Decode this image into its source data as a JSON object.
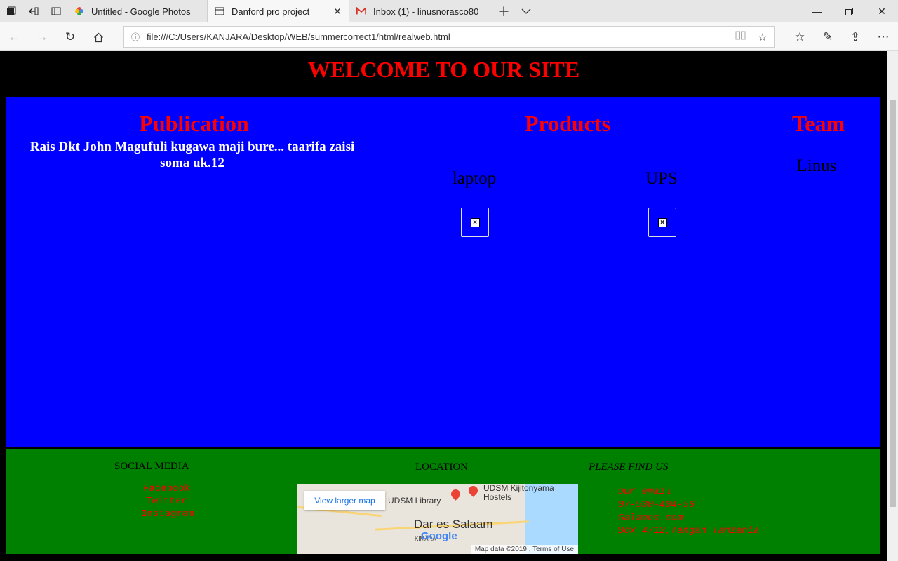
{
  "browser": {
    "tabs": [
      {
        "title": "Untitled - Google Photos"
      },
      {
        "title": "Danford pro project"
      },
      {
        "title": "Inbox (1) - linusnorasco804("
      }
    ],
    "url": "file:///C:/Users/KANJARA/Desktop/WEB/summercorrect1/html/realweb.html"
  },
  "page": {
    "welcome": "WELCOME TO OUR SITE",
    "publication": {
      "heading": "Publication",
      "text": "Rais Dkt John Magufuli kugawa maji bure... taarifa zaisi soma uk.12"
    },
    "products": {
      "heading": "Products",
      "items": [
        {
          "name": "laptop"
        },
        {
          "name": "UPS"
        }
      ]
    },
    "team": {
      "heading": "Team",
      "members": [
        "Linus"
      ]
    },
    "footer": {
      "social_heading": "SOCIAL MEDIA",
      "social_links": [
        "Facebook",
        "Twitter",
        "Instagram"
      ],
      "location_heading": "LOCATION",
      "map": {
        "view_larger": "View larger map",
        "library": "UDSM Library",
        "hostels": "UDSM Kijitonyama Hostels",
        "city": "Dar es Salaam",
        "district": "KIMARA",
        "logo": "Google",
        "attribution": "Map data ©2019 , Terms of Use"
      },
      "contact_heading": "PLEASE FIND US",
      "contacts": [
        "our email",
        "07-530-404-56",
        "Galanos.com",
        "Box 4712,Tangan Tanzania"
      ]
    }
  },
  "colors": {
    "page_bg": "#000000",
    "main_bg": "#0000ff",
    "footer_bg": "#008000",
    "heading": "#ff0000"
  }
}
